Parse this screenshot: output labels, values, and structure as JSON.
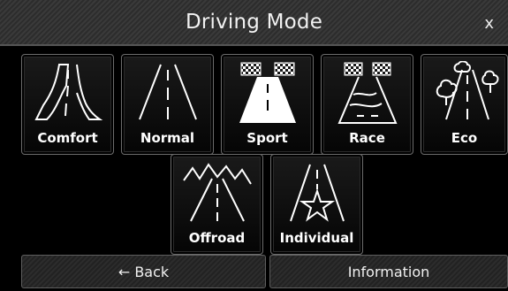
{
  "window": {
    "title": "Driving Mode",
    "close_label": "x"
  },
  "modes": [
    {
      "label": "Comfort",
      "icon": "road-curves-icon"
    },
    {
      "label": "Normal",
      "icon": "road-straight-icon"
    },
    {
      "label": "Sport",
      "icon": "road-checkered-flags-icon"
    },
    {
      "label": "Race",
      "icon": "road-race-track-icon"
    },
    {
      "label": "Eco",
      "icon": "road-trees-icon"
    },
    {
      "label": "Offroad",
      "icon": "road-mountains-icon"
    },
    {
      "label": "Individual",
      "icon": "road-star-icon"
    }
  ],
  "footer": {
    "back_label": "← Back",
    "info_label": "Information"
  }
}
